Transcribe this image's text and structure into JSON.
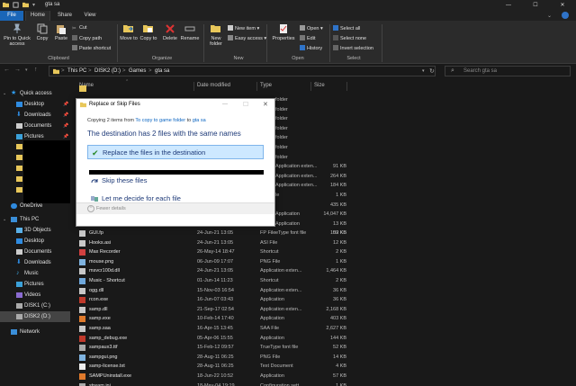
{
  "window": {
    "title": "gta sa",
    "controls": {
      "minimize": "—",
      "maximize": "☐",
      "close": "✕"
    }
  },
  "tabs": [
    "File",
    "Home",
    "Share",
    "View"
  ],
  "ribbon": {
    "clipboard": {
      "pin_label": "Pin to Quick access",
      "copy_label": "Copy",
      "paste_label": "Paste",
      "cut_label": "Cut",
      "copy_path_label": "Copy path",
      "paste_shortcut_label": "Paste shortcut",
      "group_label": "Clipboard"
    },
    "organize": {
      "move_to_label": "Move to",
      "copy_to_label": "Copy to",
      "delete_label": "Delete",
      "rename_label": "Rename",
      "group_label": "Organize"
    },
    "new": {
      "new_folder_label": "New folder",
      "new_item_label": "New item ▾",
      "easy_access_label": "Easy access ▾",
      "group_label": "New"
    },
    "open": {
      "properties_label": "Properties",
      "open_label": "Open ▾",
      "edit_label": "Edit",
      "history_label": "History",
      "group_label": "Open"
    },
    "select": {
      "select_all_label": "Select all",
      "select_none_label": "Select none",
      "invert_label": "Invert selection",
      "group_label": "Select"
    }
  },
  "address": {
    "crumbs": [
      "This PC",
      "DISK2 (D:)",
      "Games",
      "gta sa"
    ],
    "separator": ">",
    "search_placeholder": "Search gta sa"
  },
  "sidebar": {
    "quick_access": "Quick access",
    "items": [
      "Desktop",
      "Downloads",
      "Documents",
      "Pictures"
    ],
    "onedrive": "OneDrive",
    "this_pc": "This PC",
    "pc_items": [
      "3D Objects",
      "Desktop",
      "Documents",
      "Downloads",
      "Music",
      "Pictures",
      "Videos",
      "DISK1 (C:)",
      "DISK2 (D:)"
    ],
    "network": "Network"
  },
  "columns": {
    "name": "Name",
    "date": "Date modified",
    "type": "Type",
    "size": "Size"
  },
  "ghost_rows": [
    {
      "type": "folder",
      "size": ""
    },
    {
      "type": "folder",
      "size": ""
    },
    {
      "type": "folder",
      "size": ""
    },
    {
      "type": "folder",
      "size": ""
    },
    {
      "type": "folder",
      "size": ""
    },
    {
      "type": "folder",
      "size": ""
    },
    {
      "type": "folder",
      "size": ""
    },
    {
      "type": "Application exten...",
      "size": "91 KB"
    },
    {
      "type": "Application exten...",
      "size": "264 KB"
    },
    {
      "type": "Application exten...",
      "size": "184 KB"
    },
    {
      "type": "le",
      "size": "1 KB"
    },
    {
      "type": "",
      "size": "435 KB"
    },
    {
      "type": "Application",
      "size": "14,047 KB"
    },
    {
      "type": "Application",
      "size": "13 KB"
    },
    {
      "type": "eType font file",
      "size": "102 KB"
    }
  ],
  "files": [
    {
      "name": "GUI.fp",
      "date": "24-Jun-21 13:05",
      "type": "FP File",
      "size": "59 KB"
    },
    {
      "name": "Hooks.asi",
      "date": "24-Jun-21 13:05",
      "type": "ASI File",
      "size": "12 KB"
    },
    {
      "name": "Max Recorder",
      "date": "26-May-14 18:47",
      "type": "Shortcut",
      "size": "2 KB"
    },
    {
      "name": "mouse.png",
      "date": "06-Jun-09 17:07",
      "type": "PNG File",
      "size": "1 KB"
    },
    {
      "name": "msvcr100d.dll",
      "date": "24-Jun-21 13:05",
      "type": "Application exten...",
      "size": "1,464 KB"
    },
    {
      "name": "Music - Shortcut",
      "date": "01-Jun-14 11:23",
      "type": "Shortcut",
      "size": "2 KB"
    },
    {
      "name": "ogg.dll",
      "date": "15-Nov-03 16:54",
      "type": "Application exten...",
      "size": "36 KB"
    },
    {
      "name": "rcon.exe",
      "date": "16-Jun-07 03:43",
      "type": "Application",
      "size": "36 KB"
    },
    {
      "name": "samp.dll",
      "date": "21-Sep-17 02:54",
      "type": "Application exten...",
      "size": "2,168 KB"
    },
    {
      "name": "samp.exe",
      "date": "10-Feb-14 17:40",
      "type": "Application",
      "size": "403 KB"
    },
    {
      "name": "samp.saa",
      "date": "16-Apr-15 13:45",
      "type": "SAA File",
      "size": "2,627 KB"
    },
    {
      "name": "samp_debug.exe",
      "date": "05-Apr-06 15:55",
      "type": "Application",
      "size": "144 KB"
    },
    {
      "name": "sampaux3.ttf",
      "date": "15-Feb-12 09:57",
      "type": "TrueType font file",
      "size": "52 KB"
    },
    {
      "name": "sampgui.png",
      "date": "28-Aug-11 06:25",
      "type": "PNG File",
      "size": "14 KB"
    },
    {
      "name": "samp-license.txt",
      "date": "28-Aug-11 06:25",
      "type": "Text Document",
      "size": "4 KB"
    },
    {
      "name": "SAMPUninstall.exe",
      "date": "18-Jun-22 10:52",
      "type": "Application",
      "size": "57 KB"
    },
    {
      "name": "stream.ini",
      "date": "18-May-04 19:19",
      "type": "Configuration sett...",
      "size": "1 KB"
    }
  ],
  "dialog": {
    "title": "Replace or Skip Files",
    "line_prefix": "Copying 2 items from ",
    "source_link": "To copy to game folder",
    "line_mid": " to ",
    "dest_link": "gta sa",
    "heading": "The destination has 2 files with the same names",
    "options": [
      "Replace the files in the destination",
      "Skip these files",
      "Let me decide for each file"
    ],
    "fewer_details": "Fewer details",
    "controls": {
      "minimize": "—",
      "maximize": "☐",
      "close": "✕"
    }
  },
  "colors": {
    "accent": "#1a66b8",
    "folder": "#e8c75a",
    "link": "#0b65c2",
    "heading": "#1e3a78",
    "selection": "#cde8ff"
  }
}
